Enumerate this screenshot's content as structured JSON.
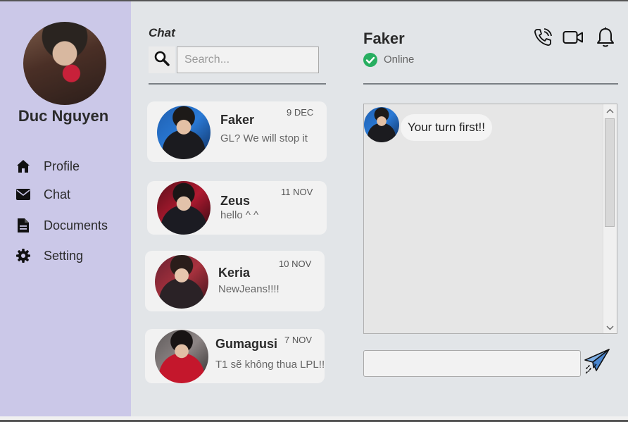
{
  "user": {
    "name": "Duc Nguyen",
    "avatar_icon": "user-avatar-photo"
  },
  "nav": [
    {
      "label": "Profile",
      "icon": "home-icon"
    },
    {
      "label": "Chat",
      "icon": "envelope-icon"
    },
    {
      "label": "Documents",
      "icon": "document-icon"
    },
    {
      "label": "Setting",
      "icon": "gear-icon"
    }
  ],
  "chat_list": {
    "title": "Chat",
    "search_placeholder": "Search...",
    "contacts": [
      {
        "name": "Faker",
        "date": "9 DEC",
        "last_message": "GL? We will stop it"
      },
      {
        "name": "Zeus",
        "date": "11 NOV",
        "last_message": "hello ^ ^"
      },
      {
        "name": "Keria",
        "date": "10 NOV",
        "last_message": "NewJeans!!!!"
      },
      {
        "name": "Gumagusi",
        "date": "7 NOV",
        "last_message": "T1 sẽ không thua LPL!!"
      }
    ]
  },
  "conversation": {
    "contact_name": "Faker",
    "status": "Online",
    "status_color": "#27ae60",
    "header_icons": [
      "phone-icon",
      "video-camera-icon",
      "bell-icon"
    ],
    "messages": [
      {
        "text": "Your turn first!!"
      }
    ],
    "input_value": "",
    "send_icon": "paper-plane-icon"
  }
}
